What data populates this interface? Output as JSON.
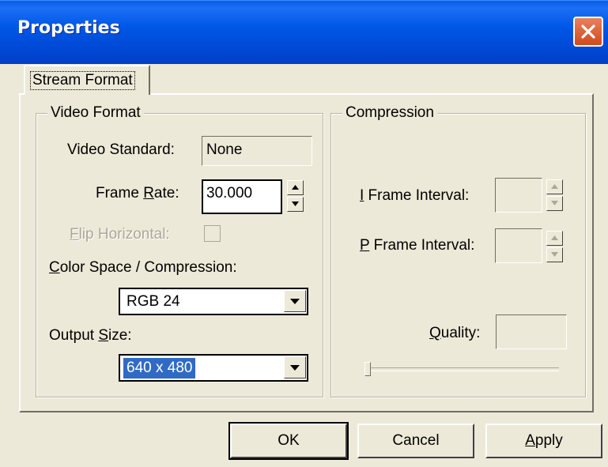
{
  "window": {
    "title": "Properties"
  },
  "tabs": [
    {
      "label": "Stream Format"
    }
  ],
  "video_format": {
    "group_label": "Video Format",
    "video_standard_label": "Video Standard:",
    "video_standard_value": "None",
    "frame_rate_label_pre": "Frame ",
    "frame_rate_label_ul": "R",
    "frame_rate_label_post": "ate:",
    "frame_rate_value": "30.000",
    "flip_horizontal_label_ul": "F",
    "flip_horizontal_label_post": "lip Horizontal:",
    "flip_horizontal_checked": false,
    "color_space_label_ul": "C",
    "color_space_label_post": "olor Space / Compression:",
    "color_space_value": "RGB 24",
    "output_size_label_pre": "Output ",
    "output_size_label_ul": "S",
    "output_size_label_post": "ize:",
    "output_size_value": "640 x 480"
  },
  "compression": {
    "group_label": "Compression",
    "i_frame_label_ul": "I",
    "i_frame_label_post": " Frame Interval:",
    "i_frame_value": "",
    "p_frame_label_ul": "P",
    "p_frame_label_post": " Frame Interval:",
    "p_frame_value": "",
    "quality_label_ul": "Q",
    "quality_label_post": "uality:",
    "quality_value": "",
    "quality_slider_level": 0
  },
  "buttons": {
    "ok": "OK",
    "cancel": "Cancel",
    "apply_ul": "A",
    "apply_post": "pply"
  },
  "colors": {
    "titlebar": "#0058e6",
    "window_bg": "#ece9d8",
    "selection": "#316ac5",
    "close_button": "#d24a1c"
  },
  "icons": [
    "close-icon",
    "spin-up-icon",
    "spin-down-icon",
    "dropdown-arrow-icon"
  ]
}
